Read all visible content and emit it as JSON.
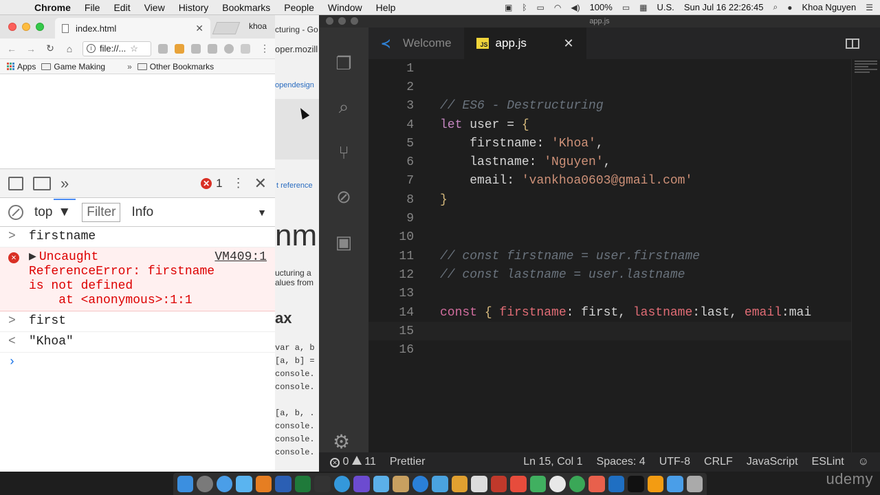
{
  "menubar": {
    "app": "Chrome",
    "menus": [
      "File",
      "Edit",
      "View",
      "History",
      "Bookmarks",
      "People",
      "Window",
      "Help"
    ],
    "battery": "100%",
    "input": "U.S.",
    "clock": "Sun Jul 16  22:26:45",
    "user": "Khoa Nguyen"
  },
  "chrome": {
    "tab_title": "index.html",
    "profile": "khoa",
    "url": "file://...",
    "bookmarks": {
      "apps": "Apps",
      "game_making": "Game Making",
      "other": "Other Bookmarks"
    },
    "devtools": {
      "error_count": "1",
      "context": "top",
      "filter_placeholder": "Filter",
      "level": "Info"
    },
    "console": {
      "in1": "firstname",
      "err_title": "Uncaught",
      "err_src": "VM409:1",
      "err_line1": "ReferenceError: firstname",
      "err_line2": "is not defined",
      "err_line3": "    at <anonymous>:1:1",
      "in2": "first",
      "out2": "\"Khoa\""
    }
  },
  "bg_window": {
    "t1": "cturing - Go",
    "t2": "oper.mozill",
    "t2b": "g",
    "t2c": "Rea",
    "t3": "opendesign",
    "t4": "t reference",
    "t5": "nm",
    "t6a": "ucturing a",
    "t6b": "alues from",
    "t8": "ax",
    "code1": "var a, b",
    "code2": "[a, b] =",
    "code3": "console.",
    "code4": "console.",
    "code5": "[a, b, .",
    "code6": "console.",
    "code7": "console.",
    "code8": "console."
  },
  "vscode": {
    "window_title": "app.js",
    "tab_welcome": "Welcome",
    "tab_active": "app.js",
    "lines": {
      "l3": "// ES6 - Destructuring",
      "l4_kw": "let",
      "l4_id": " user = ",
      "l4_brace": "{",
      "l5_key": "firstname",
      "l5_val": "'Khoa'",
      "l6_key": "lastname",
      "l6_val": "'Nguyen'",
      "l7_key": "email",
      "l7_val": "'vankhoa0603@gmail.com'",
      "l8_brace": "}",
      "l11": "// const firstname = user.firstname",
      "l12": "// const lastname = user.lastname",
      "l14_kw": "const",
      "l14_open": " { ",
      "l14_k1": "firstname",
      "l14_v1": ": first, ",
      "l14_k2": "lastname",
      "l14_v2": ":last, ",
      "l14_k3": "email",
      "l14_v3": ":mai"
    },
    "status": {
      "errors": "0",
      "warnings": "11",
      "prettier": "Prettier",
      "cursor": "Ln 15, Col 1",
      "spaces": "Spaces: 4",
      "encoding": "UTF-8",
      "eol": "CRLF",
      "language": "JavaScript",
      "linter": "ESLint"
    }
  },
  "watermark": "udemy"
}
